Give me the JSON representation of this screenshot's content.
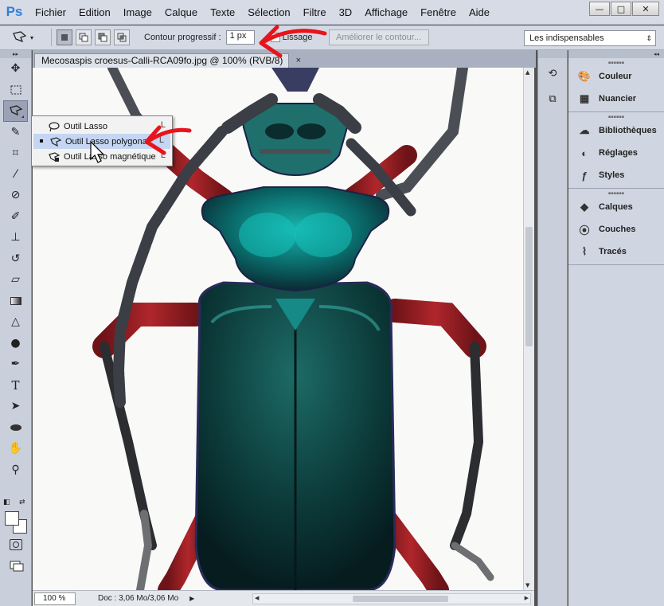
{
  "app": {
    "logo": "Ps"
  },
  "menu": [
    "Fichier",
    "Edition",
    "Image",
    "Calque",
    "Texte",
    "Sélection",
    "Filtre",
    "3D",
    "Affichage",
    "Fenêtre",
    "Aide"
  ],
  "window_controls": {
    "minimize": "—",
    "maximize": "□",
    "close": "✕"
  },
  "options_bar": {
    "feather_label": "Contour progressif :",
    "feather_value": "1 px",
    "antialias_label": "Lissage",
    "refine_button": "Améliorer le contour...",
    "workspace": "Les indispensables"
  },
  "document": {
    "tab_title": "Mecosaspis croesus-Calli-RCA09fo.jpg @ 100% (RVB/8)",
    "tab_close": "×",
    "zoom": "100 %",
    "doc_info": "Doc : 3,06 Mo/3,06 Mo"
  },
  "flyout": {
    "items": [
      {
        "label": "Outil Lasso",
        "shortcut": "L"
      },
      {
        "label": "Outil Lasso polygonal",
        "shortcut": "L"
      },
      {
        "label": "Outil Lasso magnétique",
        "shortcut": "L"
      }
    ],
    "selected_index": 1
  },
  "tools": [
    "move-icon",
    "marquee-icon",
    "lasso-icon",
    "quick-select-icon",
    "crop-icon",
    "eyedropper-icon",
    "healing-icon",
    "brush-icon",
    "stamp-icon",
    "history-brush-icon",
    "eraser-icon",
    "gradient-icon",
    "blur-icon",
    "dodge-icon",
    "pen-icon",
    "type-icon",
    "path-select-icon",
    "shape-icon",
    "hand-icon",
    "zoom-icon"
  ],
  "panels": {
    "group1": [
      "Couleur",
      "Nuancier"
    ],
    "group2": [
      "Bibliothèques",
      "Réglages",
      "Styles"
    ],
    "group3": [
      "Calques",
      "Couches",
      "Tracés"
    ]
  },
  "colors": {
    "menubar": "#d6dbe6",
    "accent_red": "#e8141c",
    "selection": "#c4d6f2",
    "ps_blue": "#2f7fd7"
  }
}
